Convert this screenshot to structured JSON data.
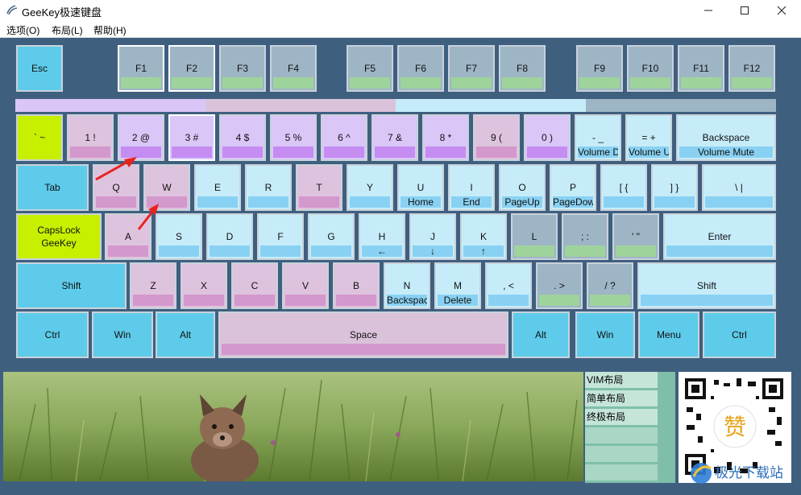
{
  "window": {
    "title": "GeeKey极速键盘",
    "minimize_glyph": "—",
    "maximize_glyph": "☐",
    "close_glyph": "✕"
  },
  "menu": [
    "选项(O)",
    "布局(L)",
    "帮助(H)"
  ],
  "colors": {
    "background": "#3f5f7f",
    "cyan": "#5ecbea",
    "light_cyan": "#c6ecfa",
    "light_cyan_bar": "#89d1f2",
    "pink": "#dec3de",
    "pink_bar": "#d398cc",
    "lavender": "#dac7f7",
    "lavender_bar": "#c58cf2",
    "grey_blue": "#9eb5c6",
    "green_bar": "#9fd39c",
    "lime": "#c6f000",
    "space": "#dac3da"
  },
  "color_bars": [
    "#dac7f7",
    "#dac3da",
    "#c6ecfa",
    "#9eb5c6"
  ],
  "rows": {
    "function": [
      {
        "id": "esc",
        "label": "Esc",
        "style": "cyan"
      },
      {
        "id": "f1",
        "label": "F1",
        "style": "grey",
        "selected": true
      },
      {
        "id": "f2",
        "label": "F2",
        "style": "grey",
        "selected": true
      },
      {
        "id": "f3",
        "label": "F3",
        "style": "grey"
      },
      {
        "id": "f4",
        "label": "F4",
        "style": "grey"
      },
      {
        "id": "f5",
        "label": "F5",
        "style": "grey"
      },
      {
        "id": "f6",
        "label": "F6",
        "style": "grey"
      },
      {
        "id": "f7",
        "label": "F7",
        "style": "grey"
      },
      {
        "id": "f8",
        "label": "F8",
        "style": "grey"
      },
      {
        "id": "f9",
        "label": "F9",
        "style": "grey"
      },
      {
        "id": "f10",
        "label": "F10",
        "style": "grey"
      },
      {
        "id": "f11",
        "label": "F11",
        "style": "grey"
      },
      {
        "id": "f12",
        "label": "F12",
        "style": "grey"
      }
    ],
    "number": [
      {
        "id": "backtick",
        "label": "` ~",
        "style": "lime"
      },
      {
        "id": "1",
        "label": "1 !",
        "style": "pink"
      },
      {
        "id": "2",
        "label": "2 @",
        "style": "lavender"
      },
      {
        "id": "3",
        "label": "3 #",
        "style": "lavender",
        "selected": true
      },
      {
        "id": "4",
        "label": "4 $",
        "style": "lavender"
      },
      {
        "id": "5",
        "label": "5 %",
        "style": "lavender"
      },
      {
        "id": "6",
        "label": "6 ^",
        "style": "lavender"
      },
      {
        "id": "7",
        "label": "7 &",
        "style": "lavender"
      },
      {
        "id": "8",
        "label": "8 *",
        "style": "lavender"
      },
      {
        "id": "9",
        "label": "9 (",
        "style": "pink"
      },
      {
        "id": "0",
        "label": "0 )",
        "style": "lavender"
      },
      {
        "id": "minus",
        "label": "- _",
        "style": "lightcyan",
        "sub": "Volume Down"
      },
      {
        "id": "equal",
        "label": "= +",
        "style": "lightcyan",
        "sub": "Volume Up"
      },
      {
        "id": "backspace",
        "label": "Backspace",
        "style": "lightcyan",
        "sub": "Volume Mute"
      }
    ],
    "top": [
      {
        "id": "tab",
        "label": "Tab",
        "style": "cyan"
      },
      {
        "id": "q",
        "label": "Q",
        "style": "pink"
      },
      {
        "id": "w",
        "label": "W",
        "style": "pink"
      },
      {
        "id": "e",
        "label": "E",
        "style": "lightcyan"
      },
      {
        "id": "r",
        "label": "R",
        "style": "lightcyan"
      },
      {
        "id": "t",
        "label": "T",
        "style": "pink"
      },
      {
        "id": "y",
        "label": "Y",
        "style": "lightcyan"
      },
      {
        "id": "u",
        "label": "U",
        "style": "lightcyan",
        "sub": "Home"
      },
      {
        "id": "i",
        "label": "I",
        "style": "lightcyan",
        "sub": "End"
      },
      {
        "id": "o",
        "label": "O",
        "style": "lightcyan",
        "sub": "PageUp"
      },
      {
        "id": "p",
        "label": "P",
        "style": "lightcyan",
        "sub": "PageDown"
      },
      {
        "id": "lbracket",
        "label": "[ {",
        "style": "lightcyan"
      },
      {
        "id": "rbracket",
        "label": "] }",
        "style": "lightcyan"
      },
      {
        "id": "backslash",
        "label": "\\ |",
        "style": "lightcyan"
      }
    ],
    "home": [
      {
        "id": "capslock",
        "label": "CapsLock",
        "label2": "GeeKey",
        "style": "lime"
      },
      {
        "id": "a",
        "label": "A",
        "style": "pink"
      },
      {
        "id": "s",
        "label": "S",
        "style": "lightcyan"
      },
      {
        "id": "d",
        "label": "D",
        "style": "lightcyan"
      },
      {
        "id": "f",
        "label": "F",
        "style": "lightcyan"
      },
      {
        "id": "g",
        "label": "G",
        "style": "lightcyan"
      },
      {
        "id": "h",
        "label": "H",
        "style": "lightcyan",
        "sub": "←"
      },
      {
        "id": "j",
        "label": "J",
        "style": "lightcyan",
        "sub": "↓"
      },
      {
        "id": "k",
        "label": "K",
        "style": "lightcyan",
        "sub": "↑"
      },
      {
        "id": "l",
        "label": "L",
        "style": "grey"
      },
      {
        "id": "semicolon",
        "label": "; :",
        "style": "grey"
      },
      {
        "id": "quote",
        "label": "' \"",
        "style": "grey"
      },
      {
        "id": "enter",
        "label": "Enter",
        "style": "lightcyan"
      }
    ],
    "bottom": [
      {
        "id": "lshift",
        "label": "Shift",
        "style": "cyan"
      },
      {
        "id": "z",
        "label": "Z",
        "style": "pink"
      },
      {
        "id": "x",
        "label": "X",
        "style": "pink"
      },
      {
        "id": "c",
        "label": "C",
        "style": "pink"
      },
      {
        "id": "v",
        "label": "V",
        "style": "pink"
      },
      {
        "id": "b",
        "label": "B",
        "style": "pink"
      },
      {
        "id": "n",
        "label": "N",
        "style": "lightcyan",
        "sub": "Backspace"
      },
      {
        "id": "m",
        "label": "M",
        "style": "lightcyan",
        "sub": "Delete"
      },
      {
        "id": "comma",
        "label": ", <",
        "style": "lightcyan"
      },
      {
        "id": "period",
        "label": ". >",
        "style": "grey"
      },
      {
        "id": "slash",
        "label": "/ ?",
        "style": "grey"
      },
      {
        "id": "rshift",
        "label": "Shift",
        "style": "lightcyan"
      }
    ],
    "space": [
      {
        "id": "lctrl",
        "label": "Ctrl",
        "style": "cyan"
      },
      {
        "id": "lwin",
        "label": "Win",
        "style": "cyan"
      },
      {
        "id": "lalt",
        "label": "Alt",
        "style": "cyan"
      },
      {
        "id": "space",
        "label": "Space",
        "style": "space"
      },
      {
        "id": "ralt",
        "label": "Alt",
        "style": "cyan"
      },
      {
        "id": "rwin",
        "label": "Win",
        "style": "cyan"
      },
      {
        "id": "menu",
        "label": "Menu",
        "style": "cyan"
      },
      {
        "id": "rctrl",
        "label": "Ctrl",
        "style": "cyan"
      }
    ]
  },
  "layouts": [
    "VIM布局",
    "简单布局",
    "终极布局"
  ],
  "qr_center_char": "赞",
  "watermark": "极光下载站"
}
